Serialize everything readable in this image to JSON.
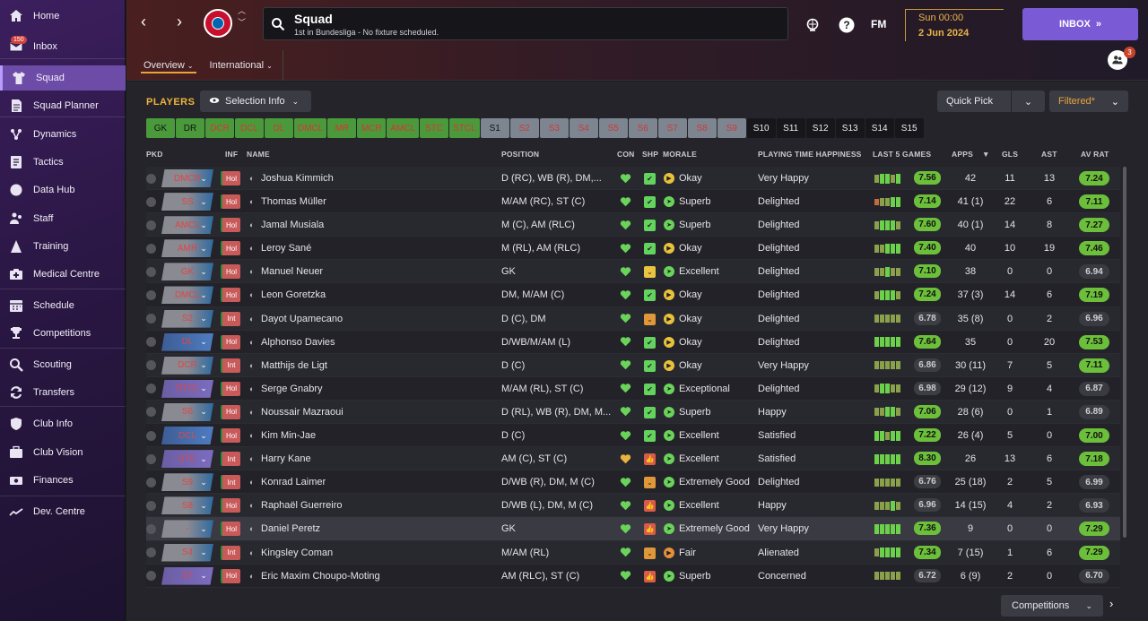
{
  "sidebar": {
    "items": [
      {
        "label": "Home",
        "icon": "home-icon"
      },
      {
        "label": "Inbox",
        "icon": "inbox-icon",
        "badge": "150"
      },
      {
        "label": "Squad",
        "icon": "shirt-icon"
      },
      {
        "label": "Squad Planner",
        "icon": "planner-icon"
      },
      {
        "label": "Dynamics",
        "icon": "dynamics-icon"
      },
      {
        "label": "Tactics",
        "icon": "tactics-icon"
      },
      {
        "label": "Data Hub",
        "icon": "data-hub-icon"
      },
      {
        "label": "Staff",
        "icon": "staff-icon"
      },
      {
        "label": "Training",
        "icon": "training-icon"
      },
      {
        "label": "Medical Centre",
        "icon": "medical-icon"
      },
      {
        "label": "Schedule",
        "icon": "calendar-icon"
      },
      {
        "label": "Competitions",
        "icon": "trophy-icon"
      },
      {
        "label": "Scouting",
        "icon": "search-icon"
      },
      {
        "label": "Transfers",
        "icon": "transfer-icon"
      },
      {
        "label": "Club Info",
        "icon": "shield-icon"
      },
      {
        "label": "Club Vision",
        "icon": "briefcase-icon"
      },
      {
        "label": "Finances",
        "icon": "money-icon"
      },
      {
        "label": "Dev. Centre",
        "icon": "dev-centre-icon"
      }
    ]
  },
  "header": {
    "title": "Squad",
    "subtitle": "1st in Bundesliga - No fixture scheduled.",
    "fm_logo": "FM",
    "date_time": "Sun 00:00",
    "date_day": "2 Jun 2024",
    "inbox_label": "INBOX",
    "avatar_badge": "3",
    "tabs": [
      {
        "label": "Overview"
      },
      {
        "label": "International"
      }
    ]
  },
  "main": {
    "section_title": "PLAYERS",
    "selection_info": "Selection Info",
    "quick_pick": "Quick Pick",
    "filtered": "Filtered*",
    "competitions": "Competitions",
    "filters": [
      "GK",
      "DR",
      "DCR",
      "DCL",
      "DL",
      "DMCL",
      "MR",
      "MCR",
      "AMCL",
      "STC",
      "STCL",
      "S1",
      "S2",
      "S3",
      "S4",
      "S5",
      "S6",
      "S7",
      "S8",
      "S9",
      "S10",
      "S11",
      "S12",
      "S13",
      "S14",
      "S15"
    ],
    "columns": {
      "pkd": "PKD",
      "inf": "INF",
      "name": "NAME",
      "position": "POSITION",
      "con": "CON",
      "shp": "SHP",
      "morale": "MORALE",
      "pth": "PLAYING TIME HAPPINESS",
      "last5": "LAST 5 GAMES",
      "apps": "APPS",
      "gls": "GLS",
      "ast": "AST",
      "avrat": "AV RAT"
    }
  },
  "players": [
    {
      "pos": "DMCR",
      "inf": "Hol",
      "name": "Joshua Kimmich",
      "position": "D (RC), WB (R), DM,...",
      "ship": "green",
      "mor": "y",
      "morale": "Okay",
      "pth": "Very Happy",
      "form": "7.56",
      "apps": "42",
      "gls": "11",
      "ast": "13",
      "avr": "7.24",
      "avr_hi": true
    },
    {
      "pos": "SS",
      "inf": "Hol",
      "name": "Thomas Müller",
      "position": "M/AM (RC), ST (C)",
      "ship": "green",
      "mor": "g",
      "morale": "Superb",
      "pth": "Delighted",
      "form": "7.14",
      "apps": "41 (1)",
      "gls": "22",
      "ast": "6",
      "avr": "7.11",
      "avr_hi": true
    },
    {
      "pos": "AMCL",
      "inf": "Hol",
      "name": "Jamal Musiala",
      "position": "M (C), AM (RLC)",
      "ship": "green",
      "mor": "g",
      "morale": "Superb",
      "pth": "Delighted",
      "form": "7.60",
      "apps": "40 (1)",
      "gls": "14",
      "ast": "8",
      "avr": "7.27",
      "avr_hi": true
    },
    {
      "pos": "AMR",
      "inf": "Hol",
      "name": "Leroy Sané",
      "position": "M (RL), AM (RLC)",
      "ship": "green",
      "mor": "y",
      "morale": "Okay",
      "pth": "Delighted",
      "form": "7.40",
      "apps": "40",
      "gls": "10",
      "ast": "19",
      "avr": "7.46",
      "avr_hi": true
    },
    {
      "pos": "GK",
      "inf": "Hol",
      "name": "Manuel Neuer",
      "position": "GK",
      "ship": "yellow",
      "mor": "g",
      "morale": "Excellent",
      "pth": "Delighted",
      "form": "7.10",
      "apps": "38",
      "gls": "0",
      "ast": "0",
      "avr": "6.94",
      "avr_hi": false
    },
    {
      "pos": "DMCL",
      "inf": "Hol",
      "name": "Leon Goretzka",
      "position": "DM, M/AM (C)",
      "ship": "green",
      "mor": "y",
      "morale": "Okay",
      "pth": "Delighted",
      "form": "7.24",
      "apps": "37 (3)",
      "gls": "14",
      "ast": "6",
      "avr": "7.19",
      "avr_hi": true
    },
    {
      "pos": "S2",
      "inf": "Int",
      "name": "Dayot Upamecano",
      "position": "D (C), DM",
      "ship": "orange",
      "mor": "y",
      "morale": "Okay",
      "pth": "Delighted",
      "form": "6.78",
      "apps": "35 (8)",
      "gls": "0",
      "ast": "2",
      "avr": "6.96",
      "avr_hi": false
    },
    {
      "pos": "DL",
      "inf": "Hol",
      "name": "Alphonso Davies",
      "position": "D/WB/M/AM (L)",
      "ship": "green",
      "mor": "y",
      "morale": "Okay",
      "pth": "Delighted",
      "form": "7.64",
      "apps": "35",
      "gls": "0",
      "ast": "20",
      "avr": "7.53",
      "avr_hi": true
    },
    {
      "pos": "DCR",
      "inf": "Int",
      "name": "Matthijs de Ligt",
      "position": "D (C)",
      "ship": "green",
      "mor": "y",
      "morale": "Okay",
      "pth": "Very Happy",
      "form": "6.86",
      "apps": "30 (11)",
      "gls": "7",
      "ast": "5",
      "avr": "7.11",
      "avr_hi": true
    },
    {
      "pos": "STCL",
      "inf": "Hol",
      "name": "Serge Gnabry",
      "position": "M/AM (RL), ST (C)",
      "ship": "green",
      "mor": "g",
      "morale": "Exceptional",
      "pth": "Delighted",
      "form": "6.98",
      "apps": "29 (12)",
      "gls": "9",
      "ast": "4",
      "avr": "6.87",
      "avr_hi": false
    },
    {
      "pos": "S6",
      "inf": "Hol",
      "name": "Noussair Mazraoui",
      "position": "D (RL), WB (R), DM, M...",
      "ship": "green",
      "mor": "g",
      "morale": "Superb",
      "pth": "Happy",
      "form": "7.06",
      "apps": "28 (6)",
      "gls": "0",
      "ast": "1",
      "avr": "6.89",
      "avr_hi": false
    },
    {
      "pos": "DCL",
      "inf": "Hol",
      "name": "Kim Min-Jae",
      "position": "D (C)",
      "ship": "green",
      "mor": "g",
      "morale": "Excellent",
      "pth": "Satisfied",
      "form": "7.22",
      "apps": "26 (4)",
      "gls": "5",
      "ast": "0",
      "avr": "7.00",
      "avr_hi": true
    },
    {
      "pos": "STC",
      "inf": "Int",
      "name": "Harry Kane",
      "position": "AM (C), ST (C)",
      "ship": "red",
      "mor": "g",
      "morale": "Excellent",
      "pth": "Satisfied",
      "form": "8.30",
      "apps": "26",
      "gls": "13",
      "ast": "6",
      "avr": "7.18",
      "avr_hi": true
    },
    {
      "pos": "S9",
      "inf": "Int",
      "name": "Konrad Laimer",
      "position": "D/WB (R), DM, M (C)",
      "ship": "orange",
      "mor": "g",
      "morale": "Extremely Good",
      "pth": "Delighted",
      "form": "6.76",
      "apps": "25 (18)",
      "gls": "2",
      "ast": "5",
      "avr": "6.99",
      "avr_hi": false
    },
    {
      "pos": "S8",
      "inf": "Hol",
      "name": "Raphaël Guerreiro",
      "position": "D/WB (L), DM, M (C)",
      "ship": "red",
      "mor": "g",
      "morale": "Excellent",
      "pth": "Happy",
      "form": "6.96",
      "apps": "14 (15)",
      "gls": "4",
      "ast": "2",
      "avr": "6.93",
      "avr_hi": false
    },
    {
      "pos": "-",
      "inf": "Hol",
      "name": "Daniel Peretz",
      "position": "GK",
      "ship": "red",
      "mor": "g",
      "morale": "Extremely Good",
      "pth": "Very Happy",
      "form": "7.36",
      "apps": "9",
      "gls": "0",
      "ast": "0",
      "avr": "7.29",
      "avr_hi": true
    },
    {
      "pos": "S4",
      "inf": "Int",
      "name": "Kingsley Coman",
      "position": "M/AM (RL)",
      "ship": "orange",
      "mor": "o",
      "morale": "Fair",
      "pth": "Alienated",
      "form": "7.34",
      "apps": "7 (15)",
      "gls": "1",
      "ast": "6",
      "avr": "7.29",
      "avr_hi": true
    },
    {
      "pos": "S7",
      "inf": "Hol",
      "name": "Eric Maxim Choupo-Moting",
      "position": "AM (RLC), ST (C)",
      "ship": "red",
      "mor": "g",
      "morale": "Superb",
      "pth": "Concerned",
      "form": "6.72",
      "apps": "6 (9)",
      "gls": "2",
      "ast": "0",
      "avr": "6.70",
      "avr_hi": false
    }
  ]
}
